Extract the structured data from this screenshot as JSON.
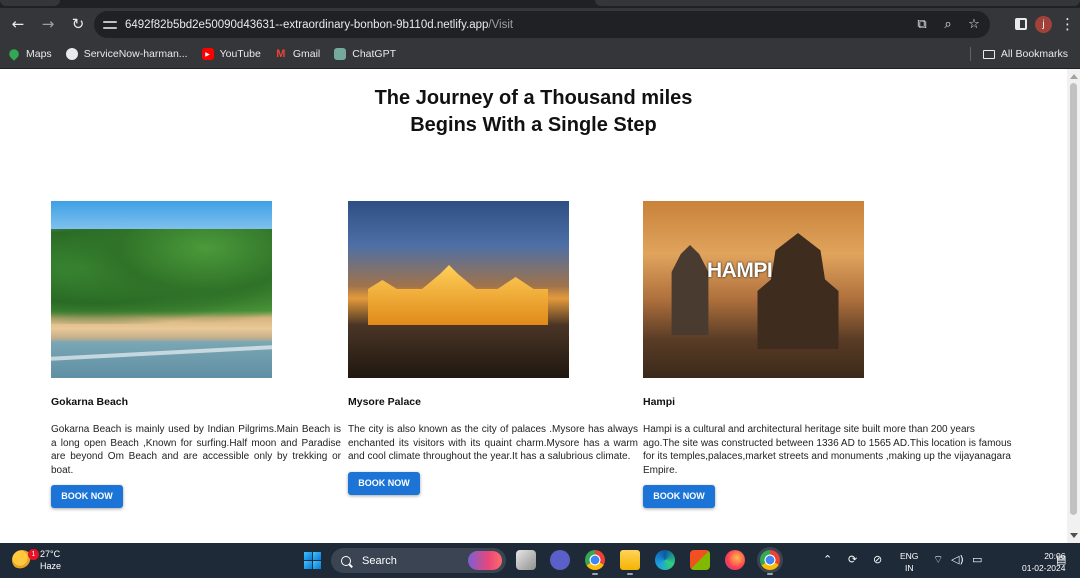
{
  "browser": {
    "url_host": "6492f82b5bd2e50090d43631--extraordinary-bonbon-9b110d.netlify.app",
    "url_path": "/Visit",
    "profile_initial": "j",
    "bookmarks": [
      {
        "label": "Maps",
        "icon": "maps-icon"
      },
      {
        "label": "ServiceNow-harman...",
        "icon": "servicenow-icon"
      },
      {
        "label": "YouTube",
        "icon": "youtube-icon"
      },
      {
        "label": "Gmail",
        "icon": "gmail-icon"
      },
      {
        "label": "ChatGPT",
        "icon": "chatgpt-icon"
      }
    ],
    "all_bookmarks_label": "All Bookmarks"
  },
  "page": {
    "heading_line1": "The Journey of a Thousand miles",
    "heading_line2": "Begins With a Single Step",
    "cards": [
      {
        "title": "Gokarna Beach",
        "description": "Gokarna Beach is mainly used by Indian Pilgrims.Main Beach is a long open Beach ,Known for surfing.Half moon and Paradise are beyond Om Beach and are accessible only by trekking or boat.",
        "button": "BOOK NOW"
      },
      {
        "title": "Mysore Palace",
        "description": "The city is also known as the city of palaces .Mysore has always enchanted its visitors with its quaint charm.Mysore has a warm and cool climate throughout the year.It has a salubrious climate.",
        "button": "BOOK NOW"
      },
      {
        "title": "Hampi",
        "image_text": "HAMPI",
        "description": "Hampi is a cultural and architectural heritage site built more than 200 years ago.The site was constructed between 1336 AD to 1565 AD.This location is famous for its temples,palaces,market streets and monuments ,making up the vijayanagara Empire.",
        "button": "BOOK NOW"
      }
    ]
  },
  "taskbar": {
    "weather_temp": "27°C",
    "weather_desc": "Haze",
    "weather_badge": "1",
    "search_label": "Search",
    "lang_line1": "ENG",
    "lang_line2": "IN",
    "time": "20:06",
    "date": "01-02-2024"
  },
  "colors": {
    "button_bg": "#1b74d6",
    "chrome_bg": "#35363a",
    "taskbar_bg": "#1f2a38"
  }
}
